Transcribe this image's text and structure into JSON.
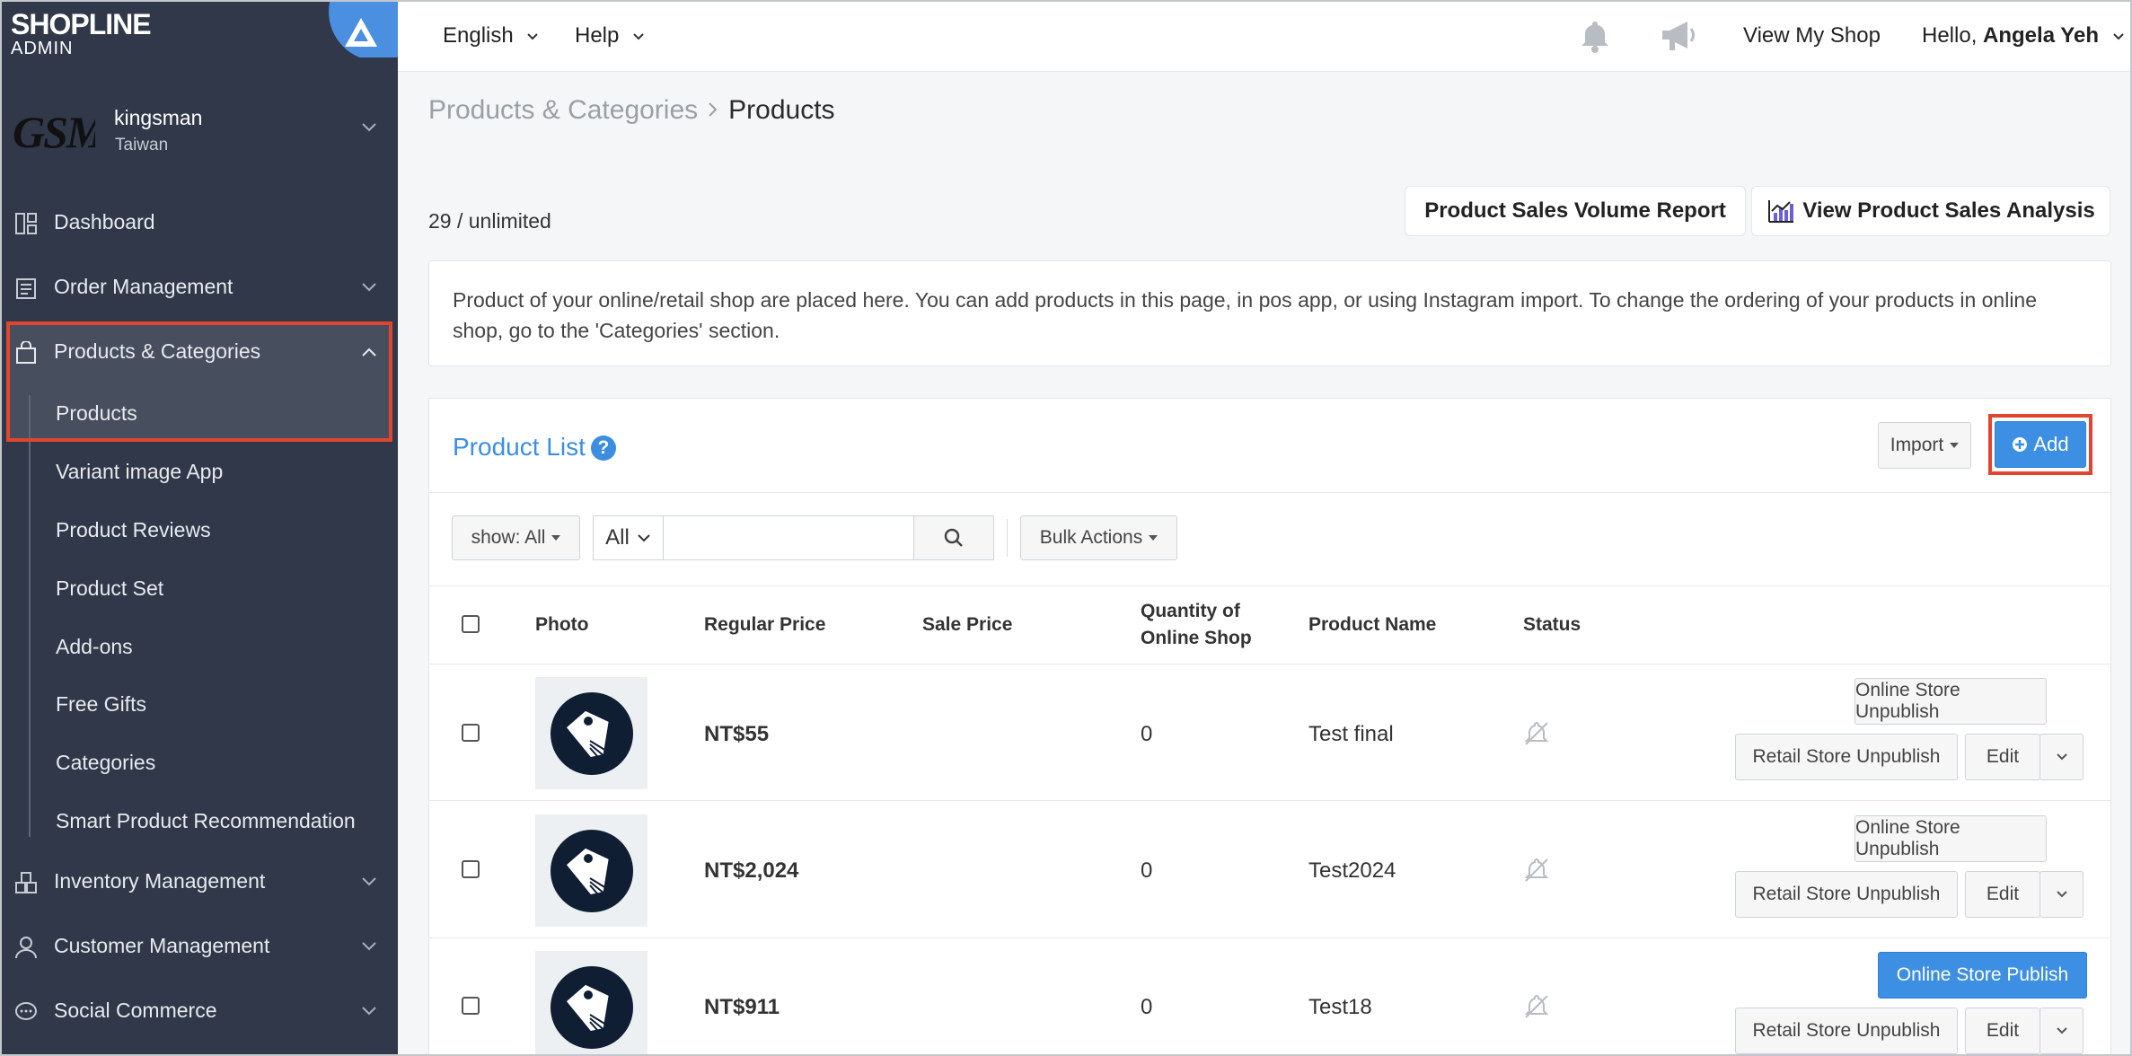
{
  "brand": {
    "logo": "SHOPLINE",
    "sub": "ADMIN"
  },
  "shop": {
    "logo_text": "GSM",
    "name": "kingsman",
    "region": "Taiwan"
  },
  "sidebar": {
    "items": [
      {
        "label": "Dashboard",
        "icon": "dashboard-icon"
      },
      {
        "label": "Order Management",
        "icon": "clipboard-icon"
      },
      {
        "label": "Products & Categories",
        "icon": "shopping-bag-icon"
      },
      {
        "label": "Inventory Management",
        "icon": "boxes-icon"
      },
      {
        "label": "Customer Management",
        "icon": "person-icon"
      },
      {
        "label": "Social Commerce",
        "icon": "chat-icon"
      }
    ],
    "sub_items": [
      "Products",
      "Variant image App",
      "Product Reviews",
      "Product Set",
      "Add-ons",
      "Free Gifts",
      "Categories",
      "Smart Product Recommendation"
    ]
  },
  "topbar": {
    "language": "English",
    "help": "Help",
    "view_shop": "View My Shop",
    "greeting": "Hello, ",
    "user": "Angela Yeh"
  },
  "breadcrumb": {
    "parent": "Products & Categories",
    "current": "Products"
  },
  "count": "29 / unlimited",
  "buttons": {
    "sales_report": "Product Sales Volume Report",
    "sales_analysis": "View Product Sales Analysis",
    "import": "Import",
    "add": "Add",
    "show": "show: All",
    "filter_all": "All",
    "bulk": "Bulk Actions"
  },
  "info_text": "Product of your online/retail shop are placed here. You can add products in this page, in pos app, or using Instagram import. To change the ordering of your products in online shop, go to the 'Categories' section.",
  "panel": {
    "title": "Product List"
  },
  "search": {
    "value": "",
    "placeholder": ""
  },
  "table": {
    "headers": {
      "photo": "Photo",
      "regular_price": "Regular Price",
      "sale_price": "Sale Price",
      "qty_line1": "Quantity of",
      "qty_line2": "Online Shop",
      "product_name": "Product Name",
      "status": "Status"
    },
    "rows": [
      {
        "regular_price": "NT$55",
        "sale_price": "",
        "quantity": "0",
        "name": "Test final",
        "online_action": "Online Store Unpublish",
        "retail_action": "Retail Store Unpublish",
        "edit": "Edit"
      },
      {
        "regular_price": "NT$2,024",
        "sale_price": "",
        "quantity": "0",
        "name": "Test2024",
        "online_action": "Online Store Unpublish",
        "retail_action": "Retail Store Unpublish",
        "edit": "Edit"
      },
      {
        "regular_price": "NT$911",
        "sale_price": "",
        "quantity": "0",
        "name": "Test18",
        "online_action": "Online Store Publish",
        "retail_action": "Retail Store Unpublish",
        "edit": "Edit"
      }
    ]
  },
  "colors": {
    "sidebar": "#303849",
    "accent": "#3d8fe3",
    "highlight": "#e1452f"
  }
}
